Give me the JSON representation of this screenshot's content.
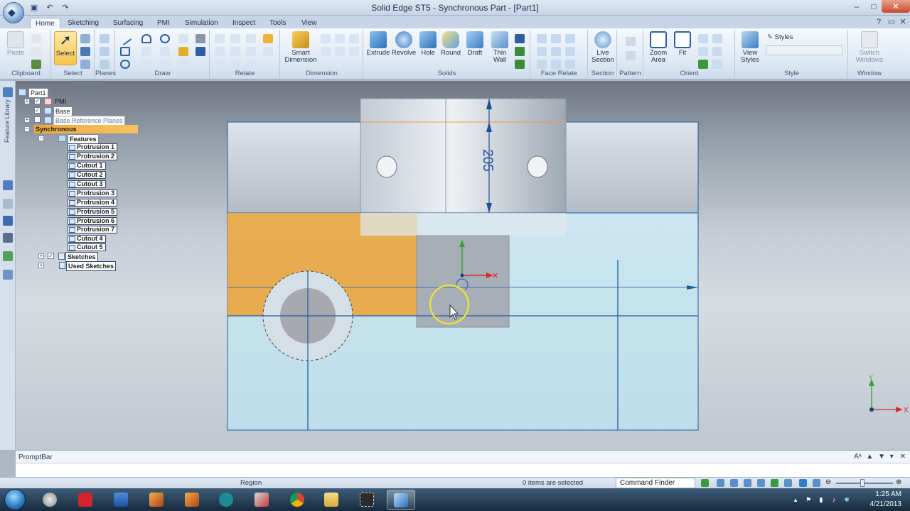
{
  "window": {
    "title": "Solid Edge ST5 - Synchronous Part - [Part1]",
    "minimize": "–",
    "maximize": "□",
    "close": "✕"
  },
  "quick_access": [
    "save-icon",
    "undo-icon",
    "redo-icon"
  ],
  "tabs": [
    "Home",
    "Sketching",
    "Surfacing",
    "PMI",
    "Simulation",
    "Inspect",
    "Tools",
    "View"
  ],
  "active_tab": "Home",
  "ribbon": {
    "clipboard": {
      "label": "Clipboard",
      "paste": "Paste"
    },
    "select": {
      "label": "Select",
      "select": "Select"
    },
    "planes": {
      "label": "Planes"
    },
    "draw": {
      "label": "Draw"
    },
    "relate": {
      "label": "Relate"
    },
    "dimension": {
      "label": "Dimension",
      "smart_dimension": "Smart Dimension"
    },
    "solids": {
      "label": "Solids",
      "extrude": "Extrude",
      "revolve": "Revolve",
      "hole": "Hole",
      "round": "Round",
      "draft": "Draft",
      "thin_wall": "Thin Wall"
    },
    "face_relate": {
      "label": "Face Relate"
    },
    "section": {
      "label": "Section",
      "live_section": "Live Section"
    },
    "pattern": {
      "label": "Pattern"
    },
    "orient": {
      "label": "Orient",
      "zoom_area": "Zoom Area",
      "fit": "Fit"
    },
    "style": {
      "label": "Style",
      "view_styles": "View Styles",
      "styles": "Styles"
    },
    "window_group": {
      "label": "Window",
      "switch_windows": "Switch Windows"
    }
  },
  "left_strip": {
    "feature_library": "Feature Library"
  },
  "tree": {
    "root": "Part1",
    "pmi": "PMI",
    "base": "Base",
    "base_ref_planes": "Base Reference Planes",
    "synchronous": "Synchronous",
    "features": "Features",
    "feature_items": [
      "Protrusion 1",
      "Protrusion 2",
      "Cutout 1",
      "Cutout 2",
      "Cutout 3",
      "Protrusion 3",
      "Protrusion 4",
      "Protrusion 5",
      "Protrusion 6",
      "Protrusion 7",
      "Cutout 4",
      "Cutout 5"
    ],
    "sketches": "Sketches",
    "used_sketches": "Used Sketches"
  },
  "viewport": {
    "dimension_value": "205",
    "triad_axes": {
      "x": "X",
      "y": "Y"
    },
    "colors": {
      "part_light": "#c8e3ec",
      "part_upper": "#c9d0d8",
      "selection_orange": "#e9a948",
      "edge_blue": "#1a5ea8",
      "dim_blue": "#1b4f9a",
      "cursor_ring": "#e8e23a"
    }
  },
  "promptbar": {
    "title": "PromptBar"
  },
  "status": {
    "region": "Region",
    "selected": "0 items are selected",
    "command_finder": "Command Finder"
  },
  "taskbar": {
    "apps": [
      "explorer-icon",
      "mathcad-icon",
      "word-icon",
      "matlab-icon",
      "matlab2-icon",
      "arduino-icon",
      "tool-icon",
      "chrome-icon",
      "folder-icon",
      "capture-icon",
      "solidedge-icon"
    ],
    "time": "1:25 AM",
    "date": "4/21/2013"
  }
}
